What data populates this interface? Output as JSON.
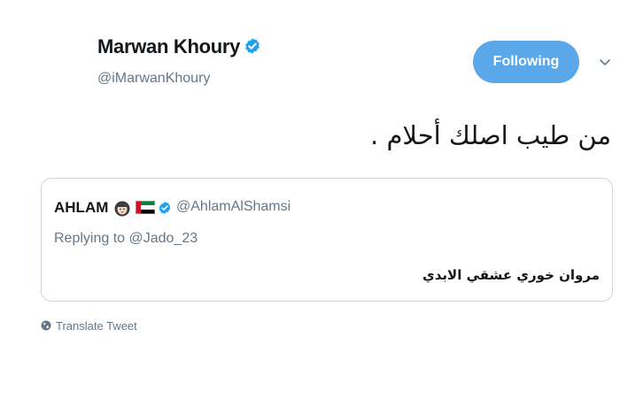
{
  "author": {
    "name": "Marwan Khoury",
    "handle": "@iMarwanKhoury",
    "verified_icon": "verified-badge-icon"
  },
  "follow_button": {
    "label": "Following",
    "color": "#5aa8ea"
  },
  "menu_icon": "chevron-down-icon",
  "tweet": {
    "text": "من طيب اصلك أحلام ."
  },
  "quoted_tweet": {
    "name": "AHLAM",
    "emoji": [
      "woman-emoji",
      "uae-flag"
    ],
    "verified_icon": "verified-badge-icon",
    "handle": "@AhlamAlShamsi",
    "replying_to": "Replying to @Jado_23",
    "text": "مروان خوري عشقي الابدي"
  },
  "translate": {
    "icon": "globe-icon",
    "label": "Translate Tweet"
  },
  "colors": {
    "accent": "#1da1f2",
    "secondary_text": "#657786",
    "border": "#ccd6dd"
  }
}
